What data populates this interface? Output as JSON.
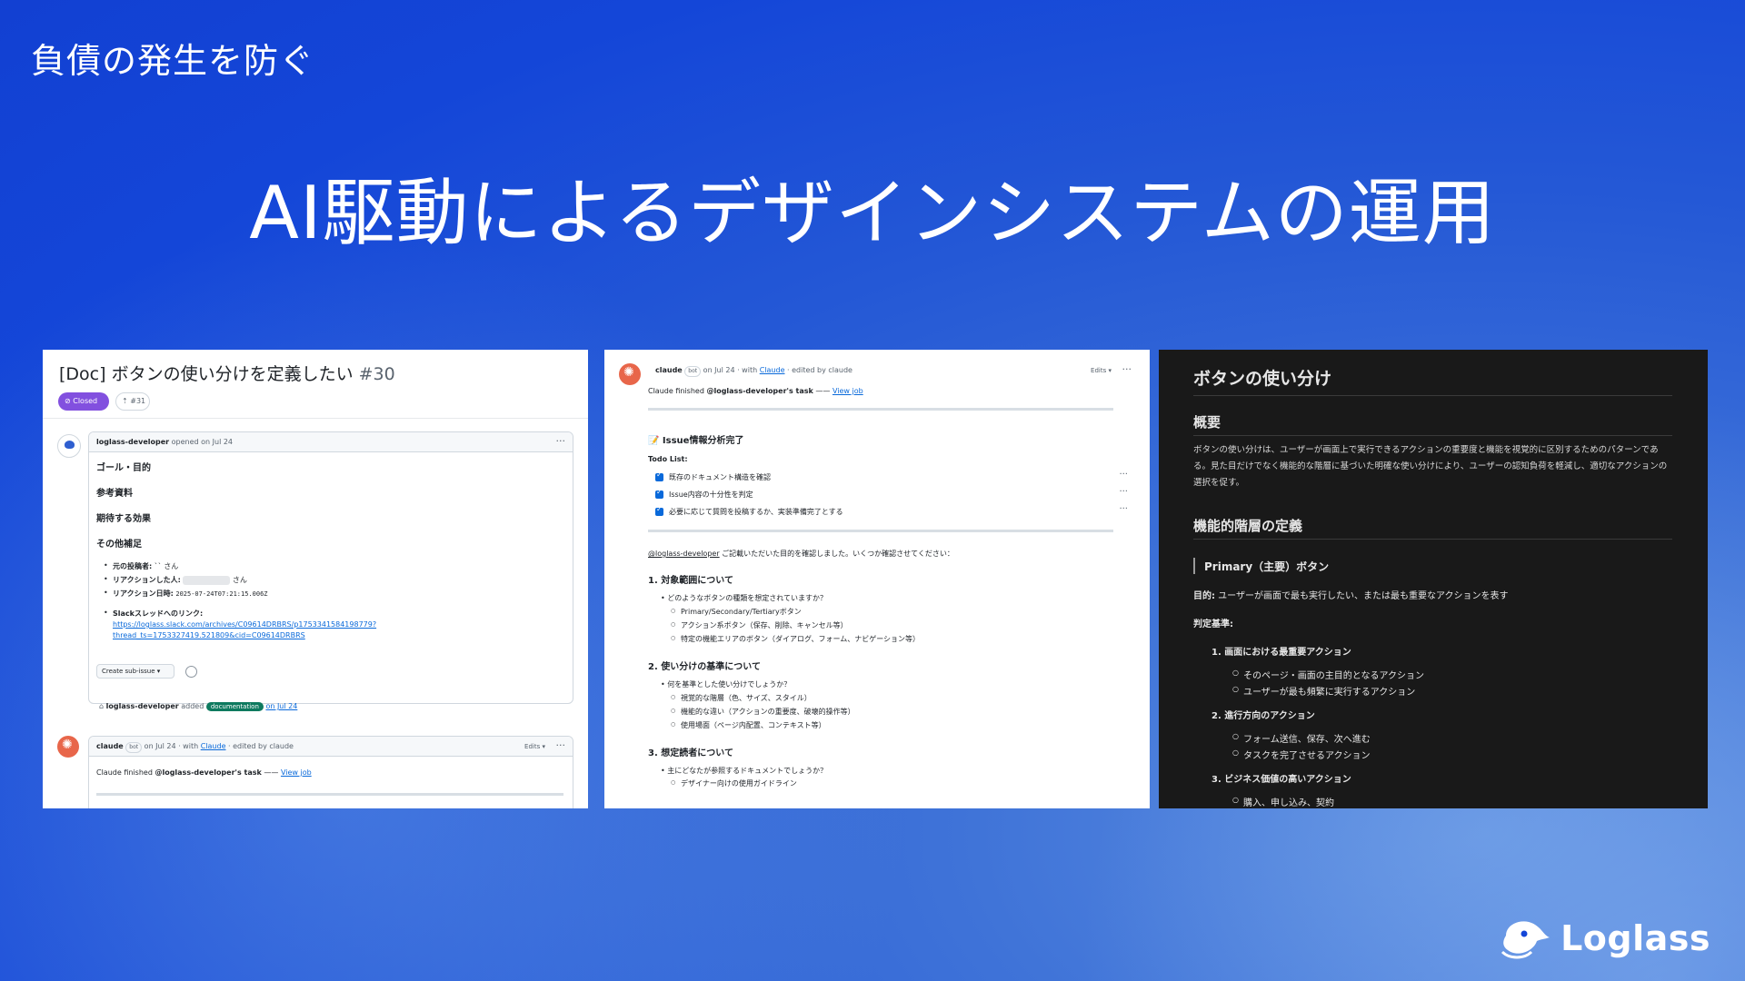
{
  "slide": {
    "subtitle": "負債の発生を防ぐ",
    "headline": "AI駆動によるデザインシステムの運用",
    "logo_text": "Loglass"
  },
  "issue": {
    "title": "[Doc] ボタンの使い分けを定義したい",
    "number": "#30",
    "status": "Closed",
    "pr_ref": "#31",
    "author_line_user": "loglass-developer",
    "author_line_rest": "opened on Jul 24",
    "sections": [
      "ゴール・目的",
      "参考資料",
      "期待する効果",
      "その他補足"
    ],
    "notes": {
      "poster_label": "元の投稿者:",
      "poster_value": "`` さん",
      "reactor_label": "リアクションした人:",
      "reactor_value": "さん",
      "date_label": "リアクション日時:",
      "date_value": "2025-07-24T07:21:15.006Z",
      "slack_label": "Slackスレッドへのリンク:",
      "slack_link_1": "https://loglass.slack.com/archives/C09614DRBRS/p1753341584198779?",
      "slack_link_2": "thread_ts=1753327419.521809&cid=C09614DRBRS"
    },
    "sub_issue_button": "Create sub-issue",
    "timeline": {
      "user": "loglass-developer",
      "action": "added",
      "label": "documentation",
      "date": "on Jul 24"
    },
    "claude_comment": {
      "user": "claude",
      "bot": "bot",
      "meta_prefix": "on Jul 24 · with",
      "meta_link": "Claude",
      "meta_suffix": "· edited by claude",
      "edits": "Edits ▾",
      "body_prefix": "Claude finished",
      "body_user": "@loglass-developer's task",
      "body_sep": "——",
      "view_job": "View job"
    },
    "dots": "···"
  },
  "claude_panel": {
    "user": "claude",
    "bot": "bot",
    "meta_prefix": "on Jul 24 · with",
    "meta_link": "Claude",
    "meta_suffix": "· edited by claude",
    "edits": "Edits ▾",
    "dots": "···",
    "finished_prefix": "Claude finished",
    "finished_user": "@loglass-developer's task",
    "finished_sep": "——",
    "view_job": "View job",
    "analysis_title": "📝 Issue情報分析完了",
    "todo_title": "Todo List:",
    "todos": [
      "既存のドキュメント構造を確認",
      "Issue内容の十分性を判定",
      "必要に応じて質問を投稿するか、実装準備完了とする"
    ],
    "intro_user": "@loglass-developer",
    "intro_text": " ご記載いただいた目的を確認しました。いくつか確認させてください：",
    "q1_title": "1. 対象範囲について",
    "q1_bullet": "どのようなボタンの種類を想定されていますか？",
    "q1_subs": [
      "Primary/Secondary/Tertiaryボタン",
      "アクション系ボタン（保存、削除、キャンセル等）",
      "特定の機能エリアのボタン（ダイアログ、フォーム、ナビゲーション等）"
    ],
    "q2_title": "2. 使い分けの基準について",
    "q2_bullet": "何を基準とした使い分けでしょうか？",
    "q2_subs": [
      "視覚的な階層（色、サイズ、スタイル）",
      "機能的な違い（アクションの重要度、破壊的操作等）",
      "使用場面（ページ内配置、コンテキスト等）"
    ],
    "q3_title": "3. 想定読者について",
    "q3_bullet": "主にどなたが参照するドキュメントでしょうか？",
    "q3_subs": [
      "デザイナー向けの使用ガイドライン"
    ]
  },
  "doc_panel": {
    "title": "ボタンの使い分け",
    "overview_heading": "概要",
    "overview_text": "ボタンの使い分けは、ユーザーが画面上で実行できるアクションの重要度と機能を視覚的に区別するためのパターンである。見た目だけでなく機能的な階層に基づいた明確な使い分けにより、ユーザーの認知負荷を軽減し、適切なアクションの選択を促す。",
    "hierarchy_heading": "機能的階層の定義",
    "primary_heading": "Primary（主要）ボタン",
    "purpose_label": "目的:",
    "purpose_text": " ユーザーが画面で最も実行したい、または最も重要なアクションを表す",
    "criteria_label": "判定基準:",
    "criteria": [
      {
        "title": "1. 画面における最重要アクション",
        "items": [
          "そのページ・画面の主目的となるアクション",
          "ユーザーが最も頻繁に実行するアクション"
        ]
      },
      {
        "title": "2. 進行方向のアクション",
        "items": [
          "フォーム送信、保存、次へ進む",
          "タスクを完了させるアクション"
        ]
      },
      {
        "title": "3. ビジネス価値の高いアクション",
        "items": [
          "購入、申し込み、契約"
        ]
      }
    ]
  },
  "colors": {
    "background": "#1446d8",
    "closed_badge": "#8250df",
    "link": "#0969da",
    "claude_avatar": "#e8664a",
    "doc_panel_bg": "#191919",
    "label_documentation": "#0e7a5f"
  }
}
